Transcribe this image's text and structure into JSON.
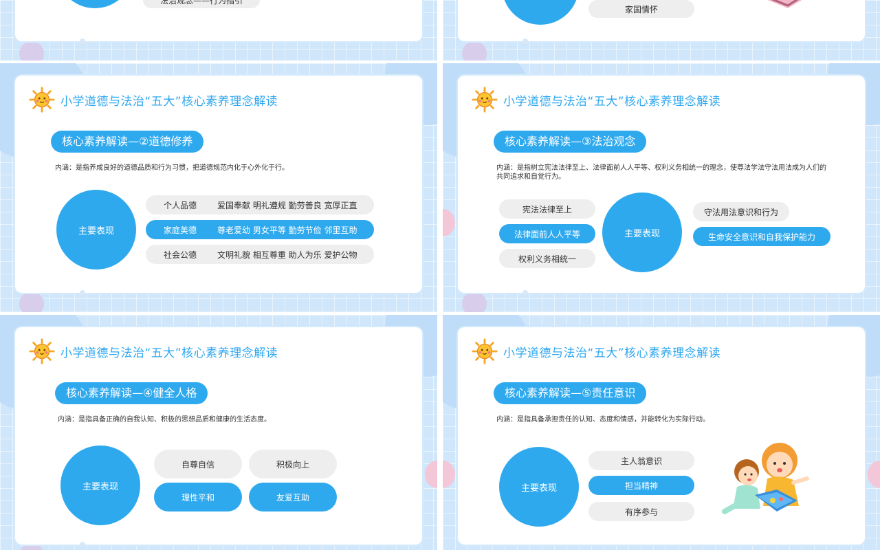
{
  "common": {
    "title": "小学道德与法治“五大”核心素养理念解读"
  },
  "top_left": {
    "pill": "法治观念——行为指引"
  },
  "top_right": {
    "pill": "家国情怀"
  },
  "slide2": {
    "heading": "核心素养解读—②道德修养",
    "desc": "内涵：是指养成良好的道德品质和行为习惯，把道德规范内化于心外化于行。",
    "circle": "主要表现",
    "rows": [
      {
        "k": "个人品德",
        "v": "爱国奉献 明礼遵规 勤劳善良 宽厚正直"
      },
      {
        "k": "家庭美德",
        "v": "尊老爱幼 男女平等 勤劳节俭 邻里互助"
      },
      {
        "k": "社会公德",
        "v": "文明礼貌 相互尊重 助人为乐 爱护公物"
      }
    ]
  },
  "slide3": {
    "heading": "核心素养解读—③法治观念",
    "desc": "内涵：是指树立宪法法律至上、法律面前人人平等、权利义务相统一的理念，使尊法学法守法用法成为人们的共同追求和自觉行为。",
    "circle": "主要表现",
    "left": [
      "宪法法律至上",
      "法律面前人人平等",
      "权利义务相统一"
    ],
    "right": [
      "守法用法意识和行为",
      "生命安全意识和自我保护能力"
    ]
  },
  "slide4": {
    "heading": "核心素养解读—④健全人格",
    "desc": "内涵：是指具备正确的自我认知、积极的思想品质和健康的生活态度。",
    "circle": "主要表现",
    "items": [
      "自尊自信",
      "积极向上",
      "理性平和",
      "友爱互助"
    ]
  },
  "slide5": {
    "heading": "核心素养解读—⑤责任意识",
    "desc": "内涵：是指具备承担责任的认知、态度和情感，并能转化为实际行动。",
    "circle": "主要表现",
    "items": [
      "主人翁意识",
      "担当精神",
      "有序参与"
    ]
  },
  "colors": {
    "accent": "#2fa9ee",
    "title": "#2ea7f0",
    "pill_grey": "#eeeeef",
    "background": "#cfe6fb"
  }
}
